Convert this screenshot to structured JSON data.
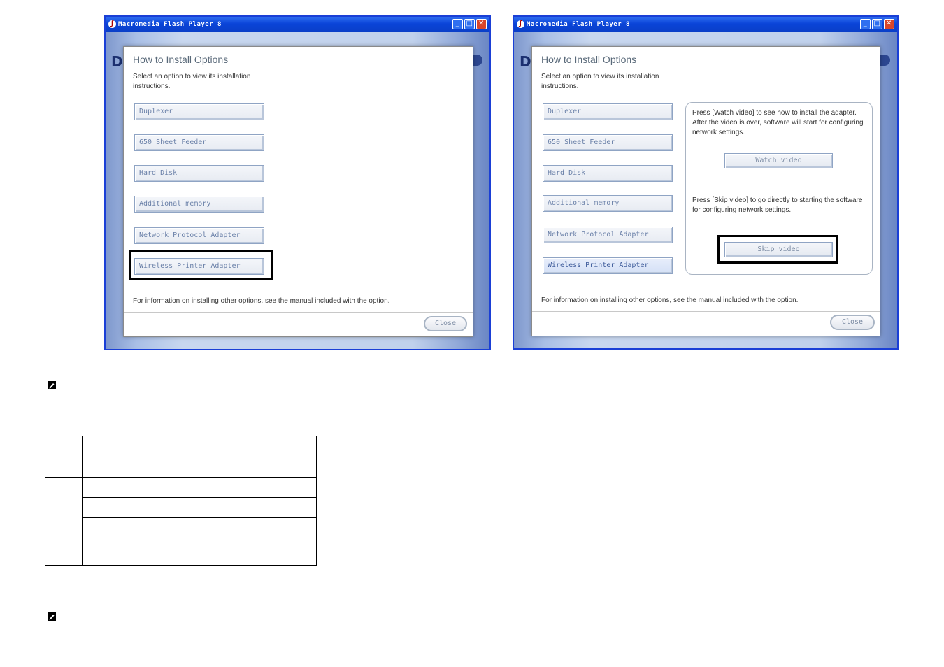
{
  "left_window": {
    "title": "Macromedia Flash Player 8",
    "window_controls": {
      "minimize": "_",
      "maximize": "□",
      "close": "✕"
    },
    "background_logo": "D",
    "dialog": {
      "title": "How to Install Options",
      "subtitle": "Select an option to view its installation instructions.",
      "options": [
        "Duplexer",
        "650 Sheet Feeder",
        "Hard Disk",
        "Additional memory",
        "Network Protocol Adapter",
        "Wireless Printer Adapter"
      ],
      "highlighted_option": "Wireless Printer Adapter",
      "footer_note": "For information on installing other options, see the manual included with the option.",
      "close_label": "Close"
    }
  },
  "right_window": {
    "title": "Macromedia Flash Player 8",
    "window_controls": {
      "minimize": "_",
      "maximize": "□",
      "close": "✕"
    },
    "background_logo": "D",
    "dialog": {
      "title": "How to Install Options",
      "subtitle": "Select an option to view its installation instructions.",
      "options": [
        "Duplexer",
        "650 Sheet Feeder",
        "Hard Disk",
        "Additional memory",
        "Network Protocol Adapter",
        "Wireless Printer Adapter"
      ],
      "selected_option": "Wireless Printer Adapter",
      "panel": {
        "watch_text": "Press [Watch video] to see how to install the adapter. After the video is over, software will start for configuring network settings.",
        "watch_label": "Watch video",
        "skip_text": "Press [Skip video] to go directly to starting the software for configuring network settings.",
        "skip_label": "Skip video",
        "highlighted_button": "Skip video"
      },
      "footer_note": "For information on installing other options, see the manual included with the option.",
      "close_label": "Close"
    }
  },
  "page": {
    "note_icon_1": "note-pencil-icon",
    "note_icon_2": "note-pencil-icon",
    "table_rows": 6
  }
}
